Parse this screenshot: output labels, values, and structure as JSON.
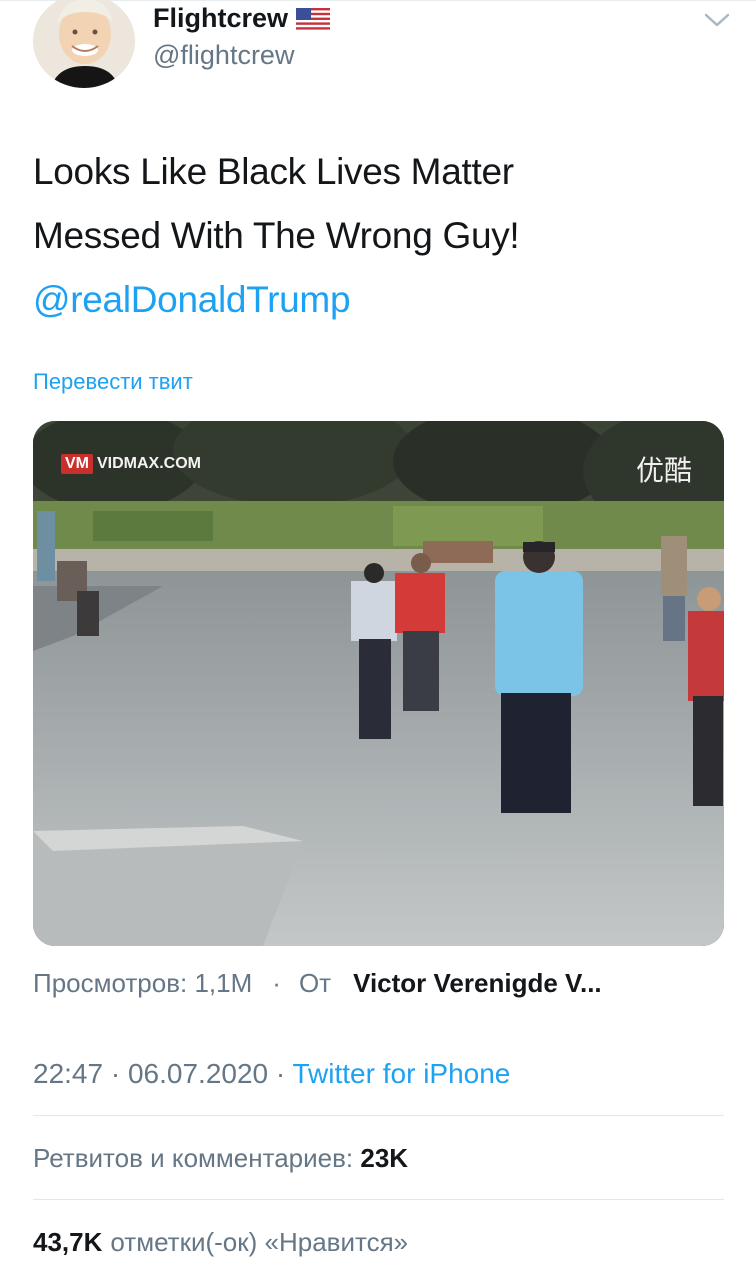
{
  "author": {
    "name": "Flightcrew",
    "flag_icon": "us-flag-icon",
    "handle": "@flightcrew"
  },
  "tweet": {
    "text_line1": "Looks Like Black Lives Matter",
    "text_line2": "Messed With The Wrong Guy!",
    "mention": "@realDonaldTrump",
    "translate_label": "Перевести твит"
  },
  "media": {
    "watermark_left": "VM VIDMAX.COM",
    "watermark_right": "优酷"
  },
  "video_meta": {
    "views": "Просмотров: 1,1M",
    "separator": "·",
    "from_label": "От",
    "source": "Victor Verenigde V..."
  },
  "timestamp": {
    "time": "22:47",
    "sep1": " · ",
    "date": "06.07.2020",
    "sep2": " · ",
    "client": "Twitter for iPhone"
  },
  "stats": {
    "retweets_label": "Ретвитов и комментариев: ",
    "retweets_count": "23K",
    "likes_count": "43,7K",
    "likes_label": "отметки(-ок) «Нравится»"
  },
  "colors": {
    "link": "#1da1f2",
    "secondary_text": "#657786",
    "primary_text": "#14171a",
    "divider": "#e1e8ed"
  }
}
